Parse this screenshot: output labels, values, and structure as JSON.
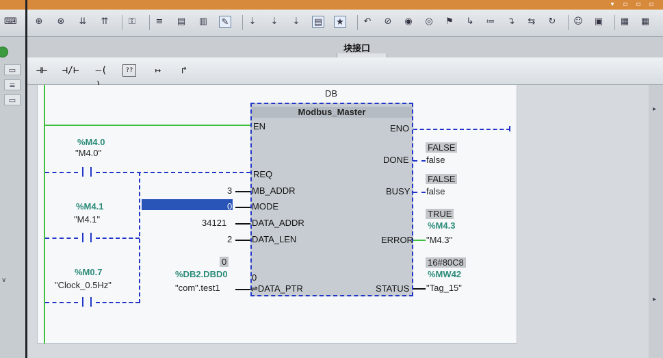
{
  "interface_label": "块接口",
  "instance_db": "DB",
  "block": {
    "title": "Modbus_Master",
    "inputs": {
      "en": "EN",
      "req": "REQ",
      "mb_addr": "MB_ADDR",
      "mode": "MODE",
      "data_addr": "DATA_ADDR",
      "data_len": "DATA_LEN",
      "data_ptr": "DATA_PTR"
    },
    "outputs": {
      "eno": "ENO",
      "done": "DONE",
      "busy": "BUSY",
      "error": "ERROR",
      "status": "STATUS"
    },
    "data_ptr_prefix": "⇌",
    "data_ptr_inner_value": "0"
  },
  "input_values": {
    "mb_addr": "3",
    "mode": "0",
    "data_addr": "34121",
    "data_len": "2",
    "data_ptr_monitor": "0",
    "data_ptr_address": "%DB2.DBD0",
    "data_ptr_symbol": "\"com\".test1"
  },
  "contacts": [
    {
      "address": "%M4.0",
      "symbol": "\"M4.0\""
    },
    {
      "address": "%M4.1",
      "symbol": "\"M4.1\""
    },
    {
      "address": "%M0.7",
      "symbol": "\"Clock_0.5Hz\""
    }
  ],
  "output_values": {
    "done_monitor": "FALSE",
    "done_value": "false",
    "busy_monitor": "FALSE",
    "busy_value": "false",
    "error_monitor": "TRUE",
    "error_address": "%M4.3",
    "error_symbol": "\"M4.3\"",
    "status_monitor": "16#80C8",
    "status_address": "%MW42",
    "status_symbol": "\"Tag_15\""
  },
  "ladder_toolbar": [
    "⊣⊢",
    "⊣/⊢",
    "–( )–",
    "??",
    "↦",
    "↱"
  ],
  "main_toolbar_icons": [
    "network-insert-icon",
    "network-delete-icon",
    "network-expand-icon",
    "network-collapse-icon",
    "key-icon",
    "align-left-icon",
    "list-view-icon",
    "split-view-icon",
    "comment-icon",
    "symbol-down-icon",
    "tag-down-icon",
    "address-down-icon",
    "list-icon",
    "favorites-icon",
    "undo-icon",
    "clear-icon",
    "monitor-icon",
    "watch-icon",
    "force-icon",
    "jump-icon",
    "step-icon",
    "call-icon",
    "compare-icon",
    "refresh-icon",
    "user-icon",
    "display-icon",
    "layout-icon",
    "panel-icon"
  ],
  "colors": {
    "power_rail": "#3fbf3f",
    "rlo_dashed": "#2136c8",
    "address": "#2b8b7a",
    "selection": "#2a55b8",
    "title_bar": "#d88a3c"
  }
}
